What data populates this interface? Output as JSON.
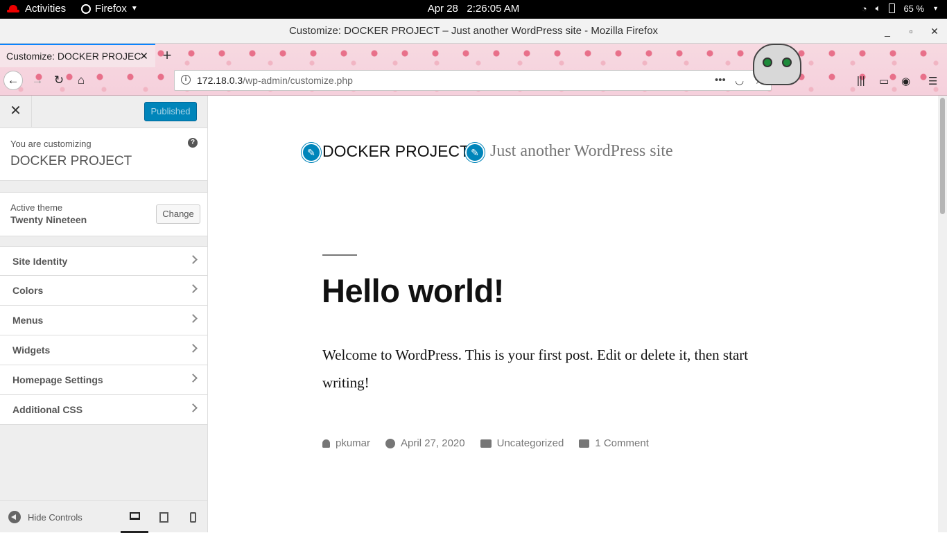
{
  "topbar": {
    "activities": "Activities",
    "app_name": "Firefox",
    "clock": "Apr 28   2:26:05 AM",
    "battery": "65 %"
  },
  "window": {
    "title": "Customize: DOCKER PROJECT – Just another WordPress site - Mozilla Firefox",
    "minimize": "_",
    "maximize": "▫",
    "close": "✕"
  },
  "browser": {
    "tab_title": "Customize: DOCKER PROJEC",
    "tab_close": "✕",
    "new_tab": "+",
    "url_host": "172.18.0.3",
    "url_path": "/wp-admin/customize.php",
    "page_actions": "•••"
  },
  "customizer": {
    "close": "✕",
    "publish_button": "Published",
    "customizing_label": "You are customizing",
    "site_name": "DOCKER PROJECT",
    "help": "?",
    "active_theme_label": "Active theme",
    "active_theme_name": "Twenty Nineteen",
    "change_button": "Change",
    "sections": [
      {
        "label": "Site Identity"
      },
      {
        "label": "Colors"
      },
      {
        "label": "Menus"
      },
      {
        "label": "Widgets"
      },
      {
        "label": "Homepage Settings"
      },
      {
        "label": "Additional CSS"
      }
    ],
    "hide_controls": "Hide Controls",
    "devices": [
      "desktop",
      "tablet",
      "mobile"
    ]
  },
  "preview": {
    "site_title": "DOCKER PROJECT",
    "site_description": "Just another WordPress site",
    "post_title": "Hello world!",
    "post_body": "Welcome to WordPress. This is your first post. Edit or delete it, then start writing!",
    "meta": {
      "author": "pkumar",
      "date": "April 27, 2020",
      "category": "Uncategorized",
      "comments": "1 Comment"
    }
  },
  "colors": {
    "wp_blue": "#0085ba",
    "text": "#111111",
    "muted": "#767676"
  }
}
